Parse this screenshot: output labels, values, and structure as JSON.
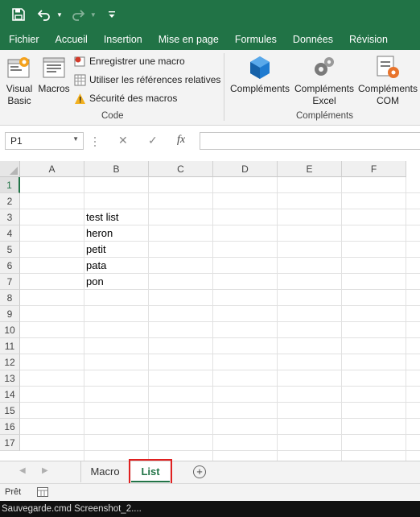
{
  "qat": {
    "save_icon": "save-icon",
    "undo_icon": "undo-icon",
    "redo_icon": "redo-icon",
    "customize_icon": "customize-qat-icon"
  },
  "menu_tabs": [
    "Fichier",
    "Accueil",
    "Insertion",
    "Mise en page",
    "Formules",
    "Données",
    "Révision"
  ],
  "ribbon": {
    "code_group": {
      "visual_basic_label": "Visual Basic",
      "macros_label": "Macros",
      "record_macro_label": "Enregistrer une macro",
      "relative_refs_label": "Utiliser les références relatives",
      "macro_security_label": "Sécurité des macros",
      "group_label": "Code"
    },
    "addins_group": {
      "addins_label": "Compléments",
      "excel_addins_label": "Compléments Excel",
      "com_addins_label": "Compléments COM",
      "group_label": "Compléments"
    }
  },
  "formula_bar": {
    "name_box": "P1",
    "fx_label": "fx",
    "formula": ""
  },
  "grid": {
    "columns": [
      "A",
      "B",
      "C",
      "D",
      "E",
      "F"
    ],
    "rows": [
      "1",
      "2",
      "3",
      "4",
      "5",
      "6",
      "7",
      "8",
      "9",
      "10",
      "11",
      "12",
      "13",
      "14",
      "15",
      "16",
      "17"
    ],
    "cells": {
      "B3": "test list",
      "B4": "heron",
      "B5": "petit",
      "B6": "pata",
      "B7": "pon"
    }
  },
  "sheets": {
    "tabs": [
      "Macro",
      "List"
    ],
    "active": "List"
  },
  "status_bar": {
    "ready_label": "Prêt"
  },
  "taskbar": {
    "text": "Sauvegarde.cmd   Screenshot_2...."
  },
  "colors": {
    "accent": "#217346",
    "highlight": "#e02020"
  }
}
